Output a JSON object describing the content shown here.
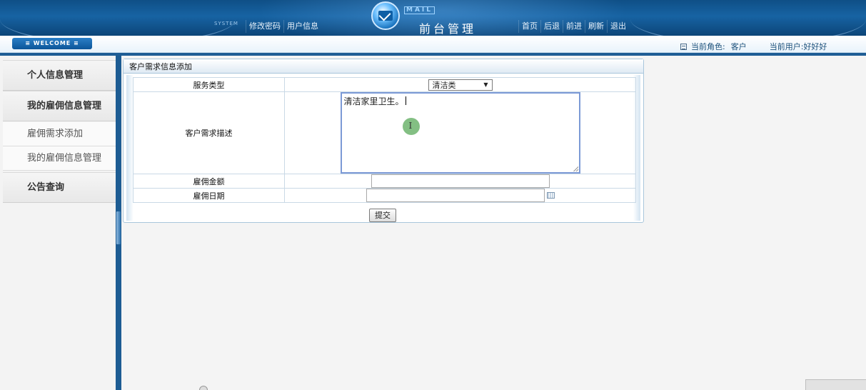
{
  "header": {
    "system_label": "SYSTEM",
    "mail_label": "MAIL",
    "app_title": "前台管理",
    "nav_left": [
      "修改密码",
      "用户信息"
    ],
    "nav_right": [
      "首页",
      "后退",
      "前进",
      "刷新",
      "退出"
    ]
  },
  "welcome": {
    "label": "≡ WELCOME ≡",
    "role_label": "当前角色:",
    "role_value": "客户",
    "user_label": "当前用户:",
    "user_value": "好好好"
  },
  "sidebar": {
    "items": [
      {
        "label": "个人信息管理",
        "type": "head"
      },
      {
        "label": "我的雇佣信息管理",
        "type": "head"
      },
      {
        "label": "雇佣需求添加",
        "type": "sub"
      },
      {
        "label": "我的雇佣信息管理",
        "type": "sub"
      },
      {
        "label": "公告查询",
        "type": "head"
      }
    ]
  },
  "form": {
    "title": "客户需求信息添加",
    "service_type_label": "服务类型",
    "service_type_value": "清洁类",
    "description_label": "客户需求描述",
    "description_value": "清洁家里卫生。",
    "amount_label": "雇佣金额",
    "amount_value": "",
    "date_label": "雇佣日期",
    "date_value": "",
    "submit_label": "提交"
  },
  "colors": {
    "header_bg": "#1763a3",
    "divider": "#1d5c93",
    "panel_border": "#a9c6dc",
    "textarea_focus": "#7c9ad6"
  }
}
